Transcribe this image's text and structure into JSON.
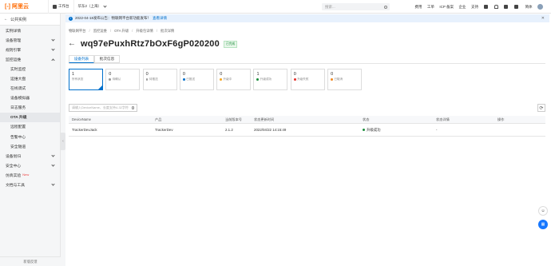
{
  "topbar": {
    "logo": "阿里云",
    "workbench": "工作台",
    "region": "华东2（上海）",
    "search_placeholder": "搜索...",
    "right": [
      "费用",
      "工单",
      "ICP 备案",
      "企业",
      "支持"
    ],
    "lang": "简体"
  },
  "sidebar": {
    "head": "公共实例",
    "items": [
      {
        "label": "实例详情",
        "type": "item"
      },
      {
        "label": "设备管理",
        "type": "group"
      },
      {
        "label": "规则引擎",
        "type": "group"
      },
      {
        "label": "监控运维",
        "type": "group-open"
      },
      {
        "label": "实时监控",
        "type": "sub"
      },
      {
        "label": "运维大盘",
        "type": "sub"
      },
      {
        "label": "在线调试",
        "type": "sub"
      },
      {
        "label": "设备模拟器",
        "type": "sub"
      },
      {
        "label": "日志服务",
        "type": "sub"
      },
      {
        "label": "OTA 升级",
        "type": "sub-active"
      },
      {
        "label": "远程配置",
        "type": "sub"
      },
      {
        "label": "告警中心",
        "type": "sub"
      },
      {
        "label": "安全隧道",
        "type": "sub"
      },
      {
        "label": "设备划归",
        "type": "group"
      },
      {
        "label": "安全中心",
        "type": "group"
      },
      {
        "label": "仿真实验",
        "type": "new"
      },
      {
        "label": "文档与工具",
        "type": "group"
      }
    ],
    "new_badge": "New",
    "footer": "新版反馈"
  },
  "notice": {
    "text": "2022-04-18发布公告：物联网平台新功能发布！",
    "link": "查看详情"
  },
  "breadcrumb": [
    "物联网平台",
    "监控运维",
    "OTA 升级",
    "升级包详情",
    "批次详情"
  ],
  "page": {
    "title": "wq97ePuxhRtz7bOxF6gP020200",
    "status": "已完成"
  },
  "tabs": [
    "设备列表",
    "批次信息"
  ],
  "cards": [
    {
      "value": "1",
      "label": "所有状态",
      "color": ""
    },
    {
      "value": "0",
      "label": "待确认",
      "color": "#999999"
    },
    {
      "value": "0",
      "label": "待推送",
      "color": "#999999"
    },
    {
      "value": "0",
      "label": "已推送",
      "color": "#0070cc"
    },
    {
      "value": "0",
      "label": "升级中",
      "color": "#f5a623"
    },
    {
      "value": "1",
      "label": "升级成功",
      "color": "#1e8e3e"
    },
    {
      "value": "0",
      "label": "升级失败",
      "color": "#e5322d"
    },
    {
      "value": "0",
      "label": "已取消",
      "color": "#f08a24"
    }
  ],
  "filter_placeholder": "请输入DeviceName、长度支持4-32字符",
  "table": {
    "headers": [
      "DeviceName",
      "产品",
      "当前版本号",
      "状态更新时间",
      "状态",
      "状态详情",
      "操作"
    ],
    "rows": [
      {
        "device": "TrackerDevJack",
        "product": "TrackerDev",
        "version": "2.1.2",
        "time": "2022/04/22 14:15:49",
        "status": "升级成功",
        "detail": "-",
        "action": ""
      }
    ]
  }
}
